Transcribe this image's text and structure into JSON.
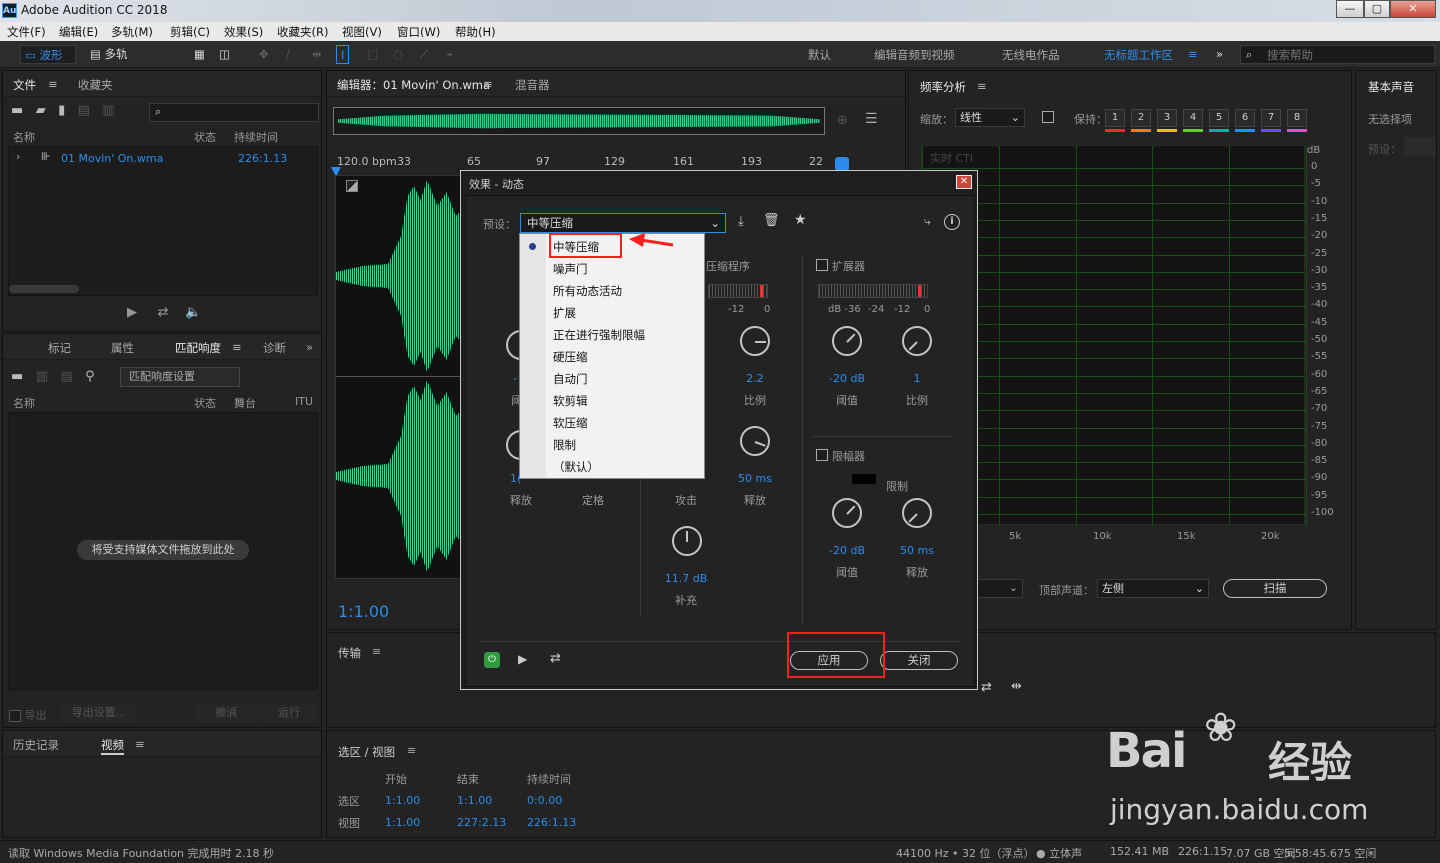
{
  "window": {
    "title": "Adobe Audition CC 2018",
    "logo": "Au",
    "min": "—",
    "max": "▢",
    "close": "✕"
  },
  "menu": [
    "文件(F)",
    "编辑(E)",
    "多轨(M)",
    "剪辑(C)",
    "效果(S)",
    "收藏夹(R)",
    "视图(V)",
    "窗口(W)",
    "帮助(H)"
  ],
  "toolbar": {
    "waveform": "波形",
    "multitrack": "多轨",
    "workspaces": [
      "默认",
      "编辑音频到视频",
      "无线电作品",
      "无标题工作区"
    ],
    "search_placeholder": "搜索帮助",
    "more": "»"
  },
  "files_panel": {
    "tabs": [
      "文件",
      "收藏夹"
    ],
    "columns": [
      "名称",
      "状态",
      "持续时间"
    ],
    "rows": [
      {
        "name": "01 Movin' On.wma",
        "duration": "226:1.13"
      }
    ]
  },
  "match_panel": {
    "tabs": [
      "标记",
      "属性",
      "匹配响度",
      "诊断"
    ],
    "settings_btn": "匹配响度设置",
    "columns": [
      "名称",
      "状态",
      "舞台",
      "ITU"
    ],
    "drop_hint": "将受支持媒体文件拖放到此处",
    "footer": [
      "导出",
      "导出设置...",
      "撤消",
      "运行"
    ]
  },
  "history_panel": {
    "tabs": [
      "历史记录",
      "视频"
    ]
  },
  "editor": {
    "tabs": [
      "编辑器：01 Movin' On.wma",
      "混音器"
    ],
    "bpm": "120.0 bpm",
    "ruler": [
      "33",
      "65",
      "97",
      "129",
      "161",
      "193",
      "22"
    ],
    "timecode": "1:1.00"
  },
  "transport": {
    "title": "传输"
  },
  "selection": {
    "title": "选区 / 视图",
    "cols": [
      "开始",
      "结束",
      "持续时间"
    ],
    "rows": [
      {
        "label": "选区",
        "start": "1:1.00",
        "end": "1:1.00",
        "dur": "0:0.00"
      },
      {
        "label": "视图",
        "start": "1:1.00",
        "end": "227:2.13",
        "dur": "226:1.13"
      }
    ]
  },
  "freq": {
    "title": "频率分析",
    "zoom_label": "缩放：",
    "zoom_value": "线性",
    "hold_label": "保持：",
    "holds": [
      "1",
      "2",
      "3",
      "4",
      "5",
      "6",
      "7",
      "8"
    ],
    "hold_colors": [
      "#e62e2e",
      "#ff7a00",
      "#e6c300",
      "#66cc33",
      "#00b3a1",
      "#1f8fff",
      "#6b4cff",
      "#e64cc8"
    ],
    "rt": "实时 CTI",
    "db_label": "dB",
    "db_ticks": [
      "0",
      "-5",
      "-10",
      "-15",
      "-20",
      "-25",
      "-30",
      "-35",
      "-40",
      "-45",
      "-50",
      "-55",
      "-60",
      "-65",
      "-70",
      "-75",
      "-80",
      "-85",
      "-90",
      "-95",
      "-100"
    ],
    "x_ticks": [
      "5k",
      "10k",
      "15k",
      "20k"
    ],
    "channel_label": "顶部声道：",
    "channel_value": "左侧",
    "scan": "扫描"
  },
  "essential": {
    "title": "基本声音",
    "no_sel": "无选择项",
    "preset": "预设："
  },
  "dialog": {
    "title": "效果 - 动态",
    "preset_label": "预设：",
    "preset_value": "中等压缩",
    "options": [
      "中等压缩",
      "噪声门",
      "所有动态活动",
      "扩展",
      "正在进行强制限幅",
      "硬压缩",
      "自动门",
      "软剪辑",
      "软压缩",
      "限制",
      "（默认）"
    ],
    "compressor": {
      "title": "压缩程序",
      "meter": [
        "-12",
        "0"
      ],
      "ratio_val": "2.2",
      "ratio_lbl": "比例",
      "release_val": "50 ms",
      "release_lbl": "释放",
      "attack_lbl": "攻击",
      "makeup_val": "11.7 dB",
      "makeup_lbl": "补充"
    },
    "gate": {
      "r1": "释放",
      "r2": "定格",
      "partial": "1("
    },
    "expander": {
      "title": "扩展器",
      "meter": [
        "dB -36",
        "-24",
        "-12",
        "0"
      ],
      "thr_val": "-20 dB",
      "thr_lbl": "阈值",
      "ratio_val": "1",
      "ratio_lbl": "比例"
    },
    "limiter": {
      "title": "限幅器",
      "limit": "限制",
      "thr_val": "-20 dB",
      "thr_lbl": "阈值",
      "rel_val": "50 ms",
      "rel_lbl": "释放"
    },
    "apply": "应用",
    "close": "关闭"
  },
  "status": {
    "left": "读取 Windows Media Foundation 完成用时 2.18 秒",
    "items": [
      "44100 Hz • 32 位（浮点）",
      "● 立体声",
      "152.41 MB",
      "226:1.15",
      "7.07 GB 空间",
      "5:58:45.675 空闲"
    ]
  },
  "watermark": {
    "brand": "Bai",
    "brand2": "经验",
    "url": "jingyan.baidu.com"
  }
}
